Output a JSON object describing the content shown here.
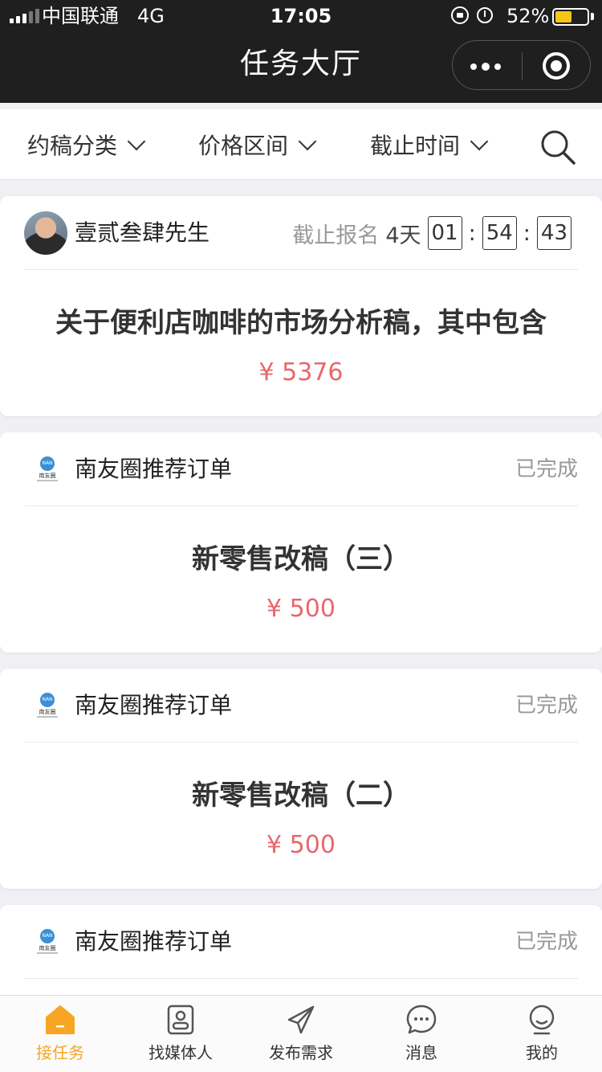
{
  "status_bar": {
    "carrier": "中国联通",
    "network": "4G",
    "time": "17:05",
    "battery_pct": "52%",
    "battery_level": 0.52
  },
  "nav": {
    "title": "任务大厅"
  },
  "filters": [
    {
      "label": "约稿分类"
    },
    {
      "label": "价格区间"
    },
    {
      "label": "截止时间"
    }
  ],
  "cards": [
    {
      "poster": "壹贰叁肆先生",
      "deadline_label": "截止报名",
      "deadline_days": "4天",
      "deadline_h": "01",
      "deadline_m": "54",
      "deadline_s": "43",
      "title": "关于便利店咖啡的市场分析稿，其中包含",
      "price": "¥ 5376"
    },
    {
      "poster": "南友圈推荐订单",
      "status": "已完成",
      "title": "新零售改稿（三）",
      "price": "¥ 500"
    },
    {
      "poster": "南友圈推荐订单",
      "status": "已完成",
      "title": "新零售改稿（二）",
      "price": "¥ 500"
    },
    {
      "poster": "南友圈推荐订单",
      "status": "已完成"
    }
  ],
  "logo": {
    "mark": "NAN",
    "text": "南友圈"
  },
  "tabbar": [
    {
      "label": "接任务",
      "icon": "home-icon",
      "active": true
    },
    {
      "label": "找媒体人",
      "icon": "contact-card-icon"
    },
    {
      "label": "发布需求",
      "icon": "paper-plane-icon"
    },
    {
      "label": "消息",
      "icon": "chat-bubble-icon"
    },
    {
      "label": "我的",
      "icon": "user-icon"
    }
  ],
  "colors": {
    "accent": "#f6a623",
    "price": "#e8676b",
    "nav_bg": "#1f1f1f"
  }
}
